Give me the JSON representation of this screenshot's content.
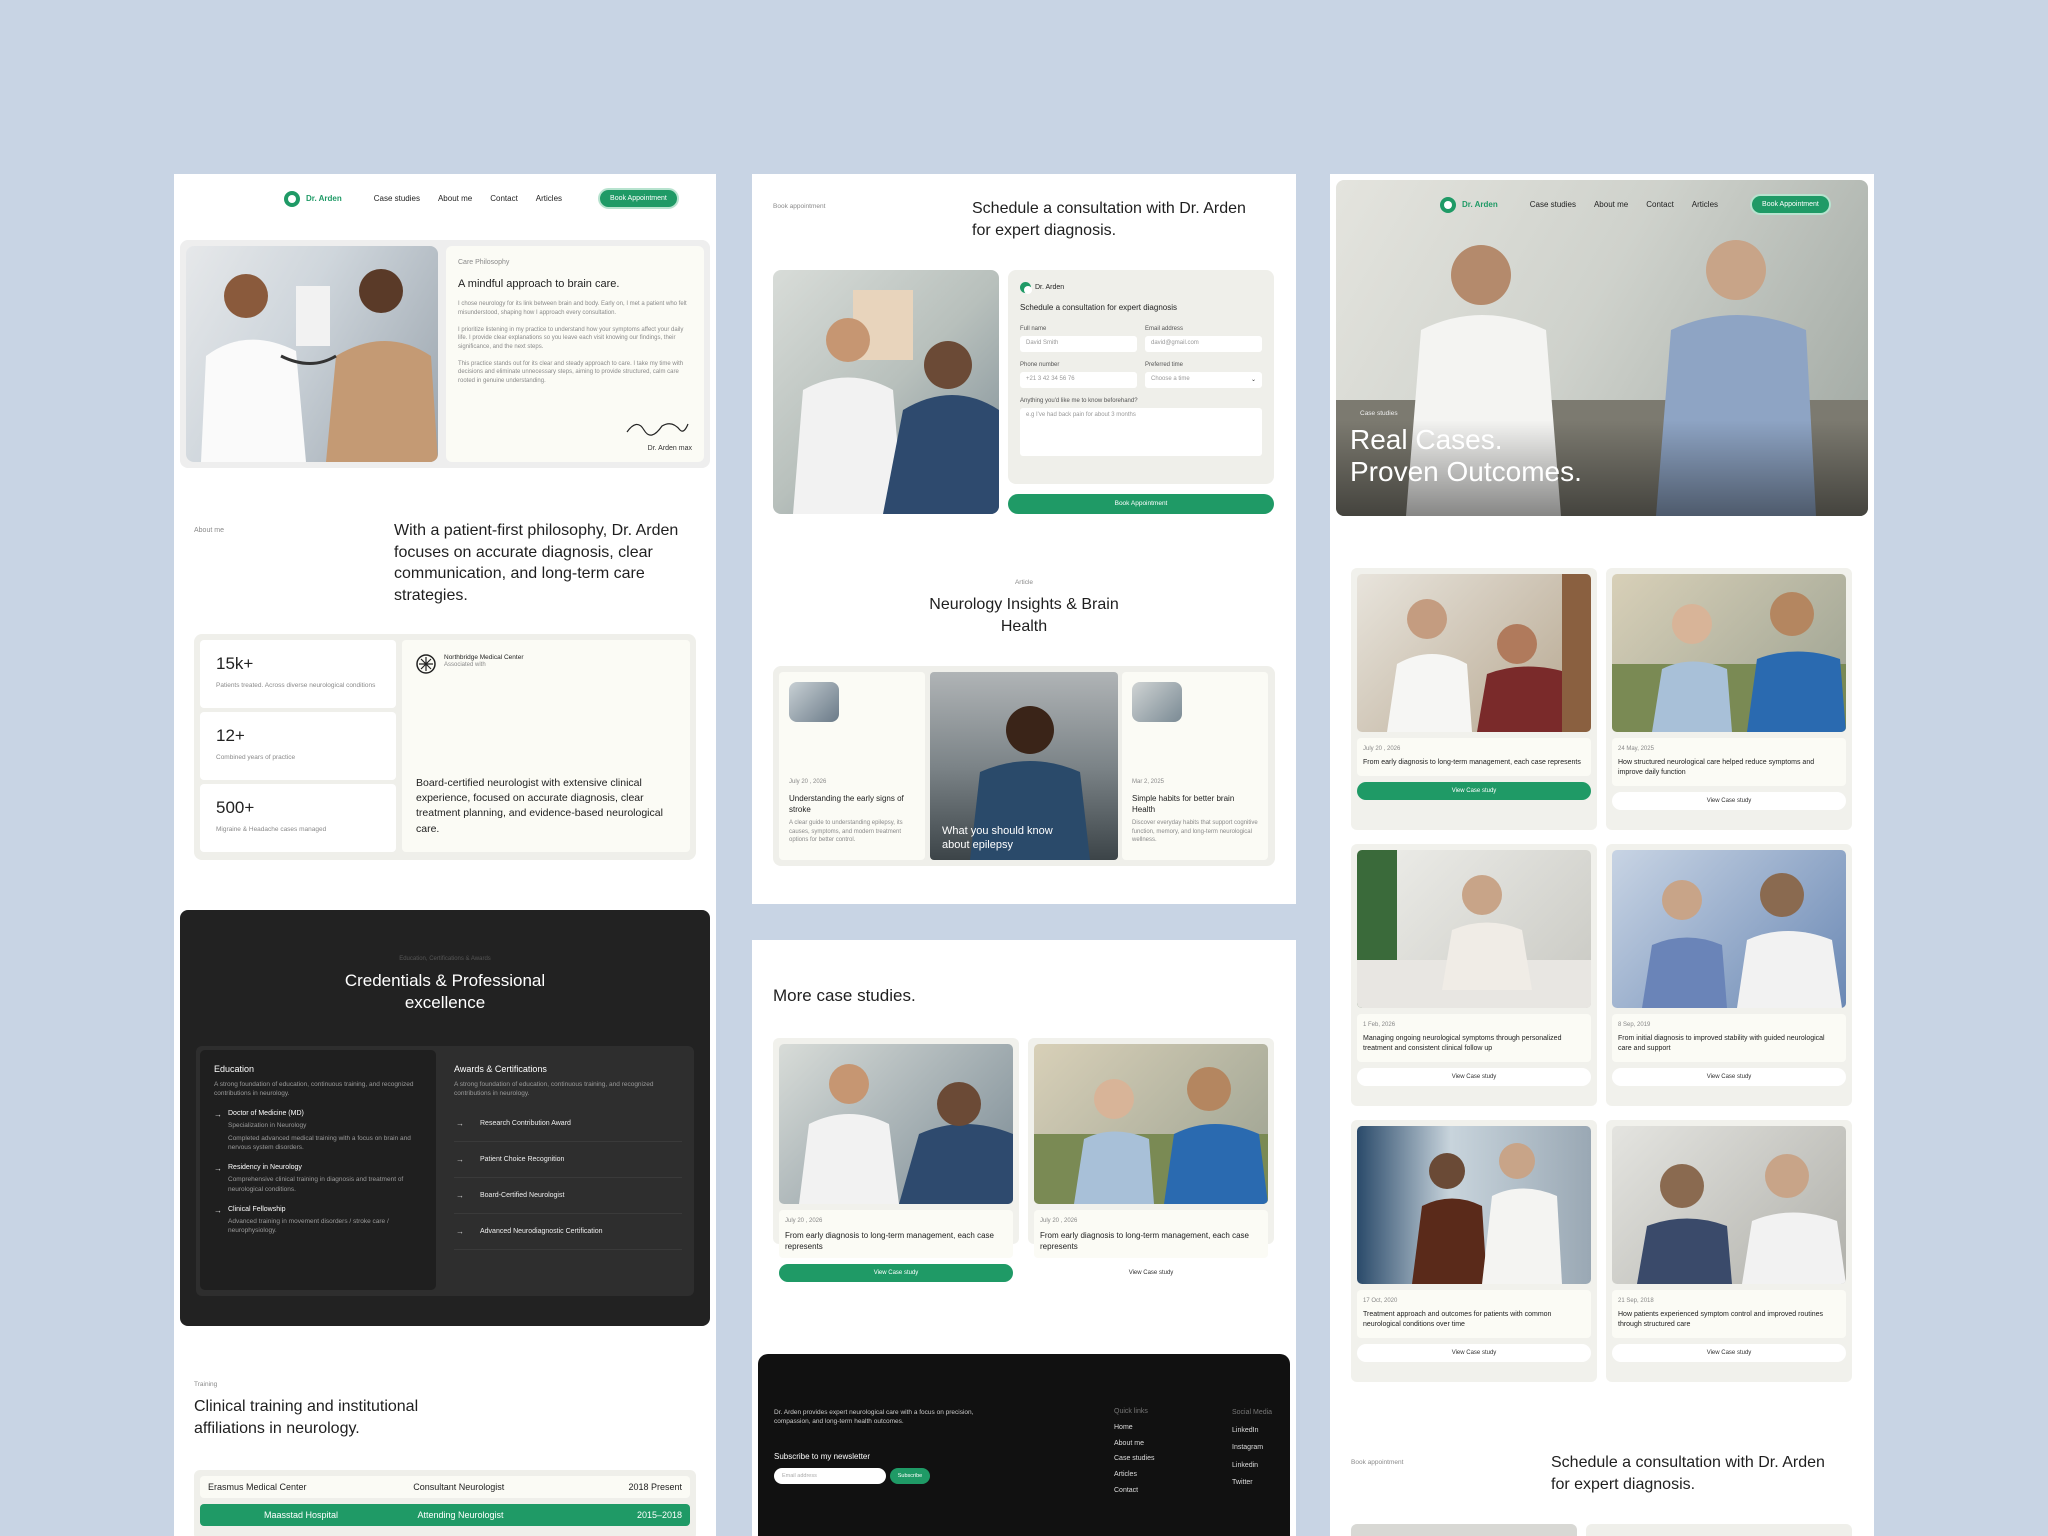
{
  "brand": "Dr. Arden",
  "nav": {
    "items": [
      "Case studies",
      "About me",
      "Contact",
      "Articles"
    ],
    "cta": "Book Appointment"
  },
  "col1": {
    "care": {
      "eyebrow": "Care Philosophy",
      "title": "A mindful approach to brain care.",
      "p1": "I chose neurology for its link between brain and body. Early on, I met a patient who felt misunderstood, shaping how I approach every consultation.",
      "p2": "I prioritize listening in my practice to understand how your symptoms affect your daily life. I provide clear explanations so you leave each visit knowing our findings, their significance, and the next steps.",
      "p3": "This practice stands out for its clear and steady approach to care. I take my time with decisions and eliminate unnecessary steps, aiming to provide structured, calm care rooted in genuine understanding.",
      "sign": "Dr. Arden max"
    },
    "about": {
      "eyebrow": "About me",
      "text": "With a patient-first philosophy, Dr. Arden focuses on accurate diagnosis, clear communication, and long-term care strategies."
    },
    "stats": [
      {
        "n": "15k+",
        "d": "Patients treated. Across diverse neurological conditions"
      },
      {
        "n": "12+",
        "d": "Combined years of practice"
      },
      {
        "n": "500+",
        "d": "Migraine & Headache cases managed"
      }
    ],
    "assoc": {
      "name": "Northbridge Medical Center",
      "sub": "Associated with",
      "text": "Board-certified neurologist with extensive clinical experience, focused on accurate diagnosis, clear treatment planning, and evidence-based neurological care."
    },
    "cred": {
      "eyebrow": "Education, Certifications & Awards",
      "title": "Credentials & Professional excellence",
      "edu": {
        "title": "Education",
        "sub": "A strong foundation of education, continuous training, and recognized contributions in neurology.",
        "items": [
          {
            "t": "Doctor of Medicine (MD)",
            "s": "Specialization in Neurology",
            "s2": "Completed advanced medical training with a focus on brain and nervous system disorders."
          },
          {
            "t": "Residency in Neurology",
            "s": "Comprehensive clinical training in diagnosis and treatment of neurological conditions."
          },
          {
            "t": "Clinical Fellowship",
            "s": "Advanced training in movement disorders / stroke care / neurophysiology."
          }
        ]
      },
      "awards": {
        "title": "Awards & Certifications",
        "sub": "A strong foundation of education, continuous training, and recognized contributions in neurology.",
        "items": [
          "Research Contribution Award",
          "Patient Choice Recognition",
          "Board-Certified Neurologist",
          "Advanced Neurodiagnostic Certification"
        ]
      }
    },
    "training": {
      "eyebrow": "Training",
      "title": "Clinical training and institutional affiliations in neurology.",
      "rows": [
        {
          "a": "Erasmus Medical Center",
          "b": "Consultant Neurologist",
          "c": "2018 Present"
        },
        {
          "a": "Maasstad Hospital",
          "b": "Attending Neurologist",
          "c": "2015–2018"
        }
      ]
    }
  },
  "col2": {
    "book": {
      "eyebrow": "Book appointment",
      "title": "Schedule a consultation with Dr. Arden for expert diagnosis.",
      "form_title": "Schedule a consultation for expert diagnosis",
      "fields": {
        "name_label": "Full name",
        "name_ph": "David Smith",
        "email_label": "Email address",
        "email_ph": "david@gmail.com",
        "phone_label": "Phone number",
        "phone_ph": "+21 3 42 34 56 76",
        "time_label": "Preferred time",
        "time_ph": "Choose a time",
        "msg_label": "Anything you'd like me to know beforehand?",
        "msg_ph": "e.g I've had back pain for about 3 months"
      },
      "submit": "Book Appointment"
    },
    "articles": {
      "eyebrow": "Article",
      "title": "Neurology Insights & Brain Health",
      "items": [
        {
          "date": "July 20 , 2026",
          "title": "Understanding the early signs of stroke",
          "desc": "A clear guide to understanding epilepsy, its causes, symptoms, and modern treatment options for better control."
        },
        {
          "title": "What you should know about epilepsy"
        },
        {
          "date": "Mar 2, 2025",
          "title": "Simple habits for better brain Health",
          "desc": "Discover everyday habits that support cognitive function, memory, and long-term neurological wellness."
        }
      ]
    },
    "more": {
      "title": "More case studies.",
      "cards": [
        {
          "date": "July 20 , 2026",
          "title": "From early diagnosis to long-term management, each case represents",
          "btn": "View Case study"
        },
        {
          "date": "July 20 , 2026",
          "title": "From early diagnosis to long-term management, each case represents",
          "btn": "View Case study"
        }
      ]
    },
    "footer": {
      "desc": "Dr. Arden provides expert neurological care with a focus on precision, compassion, and long-term health outcomes.",
      "newsletter": "Subscribe to my newsletter",
      "email_ph": "Email address",
      "subscribe": "Subscribe",
      "quick_title": "Quick links",
      "quick": [
        "Home",
        "About me",
        "Case studies",
        "Articles",
        "Contact"
      ],
      "social_title": "Social Media",
      "social": [
        "LinkedIn",
        "Instagram",
        "Linkedin",
        "Twitter"
      ]
    }
  },
  "col3": {
    "hero": {
      "eyebrow": "Case studies",
      "line1": "Real Cases.",
      "line2": "Proven Outcomes."
    },
    "cards": [
      {
        "date": "July 20 , 2026",
        "title": "From early diagnosis to long-term management, each case represents",
        "btn": "View Case study"
      },
      {
        "date": "24 May, 2025",
        "title": "How structured neurological care helped reduce symptoms and improve daily function",
        "btn": "View Case study"
      },
      {
        "date": "1 Feb, 2026",
        "title": "Managing ongoing neurological symptoms through personalized treatment and consistent clinical follow up",
        "btn": "View Case study"
      },
      {
        "date": "8 Sep, 2019",
        "title": "From initial diagnosis to improved stability with guided neurological care and support",
        "btn": "View Case study"
      },
      {
        "date": "17 Oct, 2020",
        "title": "Treatment approach and outcomes for patients with common neurological conditions over time",
        "btn": "View Case study"
      },
      {
        "date": "21 Sep, 2018",
        "title": "How patients experienced symptom control and improved routines through structured care",
        "btn": "View Case study"
      }
    ],
    "book": {
      "eyebrow": "Book appointment",
      "title": "Schedule a consultation with Dr. Arden for expert diagnosis."
    }
  }
}
